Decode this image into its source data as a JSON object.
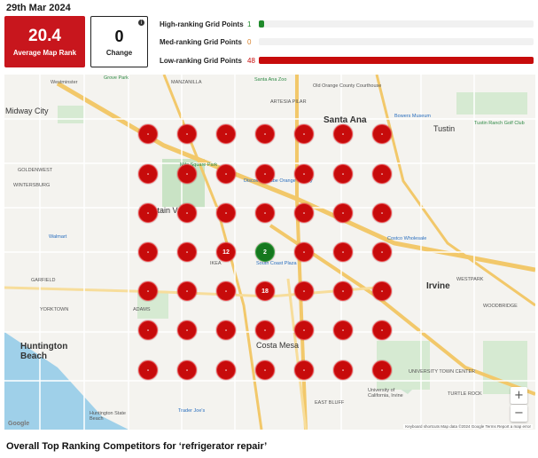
{
  "date": "29th Mar 2024",
  "rank_card": {
    "value": "20.4",
    "label": "Average Map Rank"
  },
  "change_card": {
    "value": "0",
    "label": "Change",
    "info_icon": "i"
  },
  "ranking_stats": [
    {
      "label": "High-ranking Grid Points",
      "count": "1",
      "fraction": 0.02,
      "color": "#1f8a2b",
      "num_color": "#1f8a2b"
    },
    {
      "label": "Med-ranking Grid Points",
      "count": "0",
      "fraction": 0.0,
      "color": "#e8a33a",
      "num_color": "#d9822b"
    },
    {
      "label": "Low-ranking Grid Points",
      "count": "48",
      "fraction": 1.0,
      "color": "#c70b0b",
      "num_color": "#c70b0b"
    }
  ],
  "map": {
    "grid": [
      [
        "-",
        "-",
        "-",
        "-",
        "-",
        "-",
        "-"
      ],
      [
        "-",
        "-",
        "-",
        "-",
        "-",
        "-",
        "-"
      ],
      [
        "-",
        "-",
        "-",
        "-",
        "-",
        "-",
        "-"
      ],
      [
        "-",
        "-",
        "12",
        "2",
        "-",
        "-",
        "-"
      ],
      [
        "-",
        "-",
        "-",
        "18",
        "-",
        "-",
        "-"
      ],
      [
        "-",
        "-",
        "-",
        "-",
        "-",
        "-",
        "-"
      ],
      [
        "-",
        "-",
        "-",
        "-",
        "-",
        "-",
        "-"
      ]
    ],
    "highlight": {
      "value": "2",
      "color": "#15781e"
    },
    "labels": {
      "grove_park": "Grove Park",
      "westminster": "Westminster",
      "manzanilla": "MANZANILLA",
      "santa_ana_zoo": "Santa Ana Zoo",
      "old_orange": "Old Orange County Courthouse",
      "artesia_pilar": "ARTESIA PILAR",
      "santa_ana": "Santa Ana",
      "bowers": "Bowers Museum",
      "tustin": "Tustin",
      "tustin_ranch": "Tustin Ranch Golf Club",
      "mile_square": "Mile Square Park",
      "discovery": "Discovery Cube Orange County",
      "south_coast": "South Coast Plaza",
      "costco": "Costco Wholesale",
      "irvine": "Irvine",
      "costa_mesa": "Costa Mesa",
      "huntington_beach": "Huntington Beach",
      "fountain_valley": "Fountain Valley",
      "midway_city": "Midway City",
      "goldenwest": "GOLDENWEST",
      "winterburg": "WINTERSBURG",
      "yorktown": "YORKTOWN",
      "adams": "ADAMS",
      "garfield": "GARFIELD",
      "walmart": "Walmart",
      "ikea": "IKEA",
      "uc_irvine": "University of California, Irvine",
      "trader_joes": "Trader Joe's",
      "huntington_state": "Huntington State Beach",
      "woodbridge": "WOODBRIDGE",
      "westpark": "WESTPARK",
      "turtle_rock": "TURTLE ROCK",
      "east_bluff": "EAST BLUFF",
      "university_town": "UNIVERSITY TOWN CENTER",
      "google": "Google",
      "attribution": "Keyboard shortcuts   Map data ©2024 Google   Terms   Report a map error"
    },
    "zoom_in": "+",
    "zoom_out": "−"
  },
  "competitors_title": "Overall Top Ranking Competitors for ‘refrigerator repair’"
}
